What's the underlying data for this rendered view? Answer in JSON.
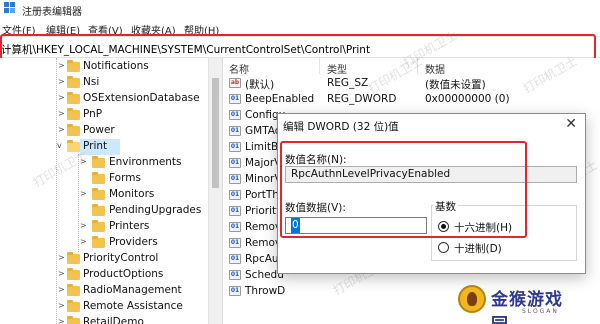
{
  "window": {
    "title": "注册表编辑器"
  },
  "menu": [
    "文件(F)",
    "编辑(E)",
    "查看(V)",
    "收藏夹(A)",
    "帮助(H)"
  ],
  "address": {
    "path": "计算机\\HKEY_LOCAL_MACHINE\\SYSTEM\\CurrentControlSet\\Control\\Print"
  },
  "tree": {
    "items": [
      {
        "label": "Notifications",
        "expanded": false,
        "selected": false
      },
      {
        "label": "Nsi",
        "expanded": false,
        "selected": false
      },
      {
        "label": "OSExtensionDatabase",
        "expanded": false,
        "selected": false
      },
      {
        "label": "PnP",
        "expanded": false,
        "selected": false
      },
      {
        "label": "Power",
        "expanded": false,
        "selected": false
      },
      {
        "label": "Print",
        "expanded": true,
        "selected": true
      },
      {
        "label": "Environments",
        "expanded": false,
        "selected": false
      },
      {
        "label": "Forms",
        "expanded": false,
        "selected": false
      },
      {
        "label": "Monitors",
        "expanded": false,
        "selected": false
      },
      {
        "label": "PendingUpgrades",
        "expanded": false,
        "selected": false
      },
      {
        "label": "Printers",
        "expanded": false,
        "selected": false
      },
      {
        "label": "Providers",
        "expanded": false,
        "selected": false
      },
      {
        "label": "PriorityControl",
        "expanded": false,
        "selected": false
      },
      {
        "label": "ProductOptions",
        "expanded": false,
        "selected": false
      },
      {
        "label": "RadioManagement",
        "expanded": false,
        "selected": false
      },
      {
        "label": "Remote Assistance",
        "expanded": false,
        "selected": false
      },
      {
        "label": "RetailDemo",
        "expanded": false,
        "selected": false
      }
    ]
  },
  "list": {
    "columns": [
      "名称",
      "类型",
      "数据"
    ],
    "rows": [
      {
        "icon": "ab",
        "name": "(默认)",
        "type": "REG_SZ",
        "data": "(数值未设置)"
      },
      {
        "icon": "dw",
        "name": "BeepEnabled",
        "type": "REG_DWORD",
        "data": "0x00000000 (0)"
      },
      {
        "icon": "dw",
        "name": "Configu",
        "type": "",
        "data": ""
      },
      {
        "icon": "dw",
        "name": "GMTAd",
        "type": "",
        "data": ""
      },
      {
        "icon": "dw",
        "name": "LimitBla",
        "type": "",
        "data": ""
      },
      {
        "icon": "dw",
        "name": "MajorV",
        "type": "",
        "data": ""
      },
      {
        "icon": "dw",
        "name": "MinorV",
        "type": "",
        "data": ""
      },
      {
        "icon": "dw",
        "name": "PortTh",
        "type": "",
        "data": ""
      },
      {
        "icon": "dw",
        "name": "Priority",
        "type": "",
        "data": ""
      },
      {
        "icon": "dw",
        "name": "Remov",
        "type": "",
        "data": ""
      },
      {
        "icon": "dw",
        "name": "Remov",
        "type": "",
        "data": ""
      },
      {
        "icon": "dw",
        "name": "RpcAut",
        "type": "",
        "data": ""
      },
      {
        "icon": "dw",
        "name": "Schedu",
        "type": "",
        "data": ""
      },
      {
        "icon": "dw",
        "name": "ThrowD",
        "type": "",
        "data": ""
      }
    ]
  },
  "dialog": {
    "title": "编辑 DWORD (32 位)值",
    "close": "✕",
    "name_label": "数值名称(N):",
    "name_value": "RpcAuthnLevelPrivacyEnabled",
    "data_label": "数值数据(V):",
    "data_value": "0",
    "base_label": "基数",
    "base_options": [
      {
        "label": "十六进制(H)",
        "selected": true
      },
      {
        "label": "十进制(D)",
        "selected": false
      }
    ]
  },
  "watermarks": [
    "打印机卫士",
    "打印机卫士",
    "打印机卫士",
    "打印机卫士",
    "打印机卫士",
    "打印机卫士"
  ],
  "logo": {
    "text": "金猴游戏园",
    "subtext": "SLOGAN"
  },
  "colors": {
    "highlight": "#e2262b",
    "selection": "#cce8ff",
    "accent": "#0078d7"
  }
}
